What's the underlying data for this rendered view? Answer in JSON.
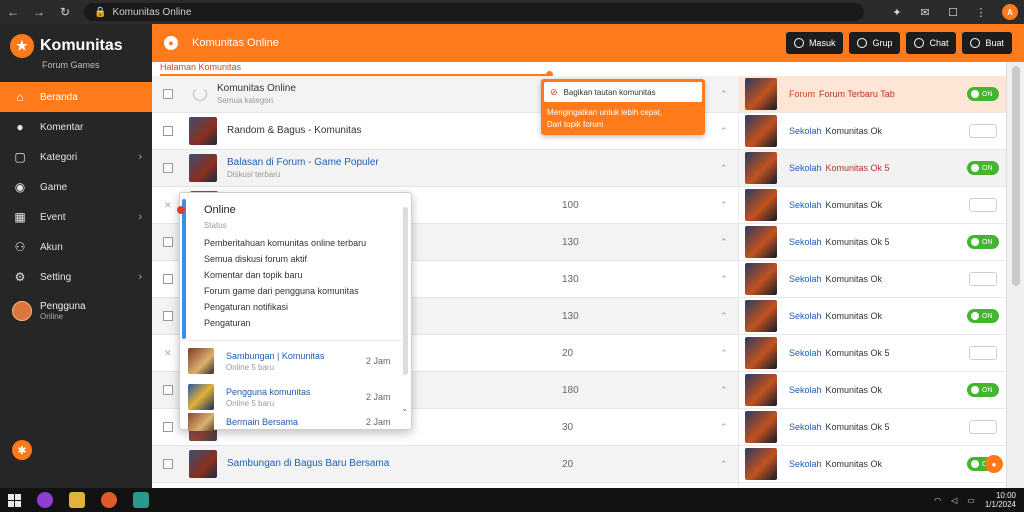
{
  "browser": {
    "url": "Komunitas Online",
    "nav_back": "←",
    "nav_forward": "→",
    "nav_reload": "↻"
  },
  "sidebar": {
    "brand_title": "Komunitas",
    "brand_sub": "Forum Games",
    "items": [
      {
        "label": "Beranda",
        "icon": "home-icon"
      },
      {
        "label": "Komentar",
        "icon": "comment-icon"
      },
      {
        "label": "Kategori",
        "icon": "category-icon"
      },
      {
        "label": "Game",
        "icon": "gamepad-icon"
      },
      {
        "label": "Event",
        "icon": "calendar-icon"
      },
      {
        "label": "Akun",
        "icon": "user-icon"
      },
      {
        "label": "Setting",
        "icon": "settings-icon"
      }
    ],
    "profile_name": "Pengguna",
    "profile_sub": "Online"
  },
  "header": {
    "title": "Komunitas Online",
    "buttons": [
      {
        "label": "Masuk"
      },
      {
        "label": "Grup"
      },
      {
        "label": "Chat"
      },
      {
        "label": "Buat"
      }
    ]
  },
  "substrip": {
    "label": "Halaman Komunitas"
  },
  "rows": [
    {
      "title": "Komunitas Online",
      "sub": "Semua kategori",
      "num": "",
      "type": "spinner",
      "dark": true
    },
    {
      "title": "Random & Bagus - Komunitas",
      "sub": "",
      "num": "",
      "type": "thumb",
      "dark": true
    },
    {
      "title": "Balasan di Forum - Game Populer",
      "sub": "Diskusi terbaru",
      "num": "",
      "type": "thumb",
      "dark": false
    },
    {
      "title": "",
      "sub": "",
      "num": "100",
      "type": "x",
      "dark": false
    },
    {
      "title": "",
      "sub": "",
      "num": "130",
      "type": "cb",
      "dark": false
    },
    {
      "title": "",
      "sub": "",
      "num": "130",
      "type": "cb",
      "dark": false
    },
    {
      "title": "",
      "sub": "",
      "num": "130",
      "type": "cb",
      "dark": false
    },
    {
      "title": "",
      "sub": "",
      "num": "20",
      "type": "x",
      "dark": false
    },
    {
      "title": "",
      "sub": "",
      "num": "180",
      "type": "cb",
      "dark": false
    },
    {
      "title": "",
      "sub": "",
      "num": "30",
      "type": "cb",
      "dark": false
    },
    {
      "title": "Sambungan di Bagus Baru Bersama",
      "sub": "",
      "num": "20",
      "type": "thumb",
      "dark": false
    }
  ],
  "tooltip": {
    "head": "Bagikan tautan komunitas",
    "body1": "Mengingatkan untuk lebih cepat,",
    "body2": "Dari topik forum"
  },
  "popup": {
    "title": "Online",
    "small": "Status",
    "lines": [
      "Pemberitahuan komunitas online terbaru",
      "Semua diskusi forum aktif",
      "Komentar dan topik baru",
      "Forum game dari pengguna komunitas",
      "Pengaturan notifikasi",
      "Pengaturan"
    ],
    "items": [
      {
        "title": "Sambungan | Komunitas",
        "sub": "Online 5 baru",
        "num": "2 Jam",
        "blue": false
      },
      {
        "title": "Pengguna komunitas",
        "sub": "Online 5 baru",
        "num": "2 Jam",
        "blue": true
      },
      {
        "title": "Bermain Bersama",
        "sub": "Online 5 baru",
        "num": "2 Jam",
        "blue": false
      }
    ]
  },
  "rpanel": [
    {
      "label": "Forum",
      "status": "Forum Terbaru Tab",
      "toggle": "on",
      "hl": true,
      "orange": true,
      "red": true
    },
    {
      "label": "Sekolah",
      "status": "Komunitas Ok",
      "toggle": "off",
      "hl": false,
      "orange": false,
      "red": false
    },
    {
      "label": "Sekolah",
      "status": "Komunitas Ok 5",
      "toggle": "on",
      "hl": false,
      "orange": false,
      "red": true,
      "alt": true
    },
    {
      "label": "Sekolah",
      "status": "Komunitas Ok",
      "toggle": "off",
      "hl": false,
      "orange": false,
      "red": false
    },
    {
      "label": "Sekolah",
      "status": "Komunitas Ok 5",
      "toggle": "on",
      "hl": false,
      "orange": false,
      "red": false
    },
    {
      "label": "Sekolah",
      "status": "Komunitas Ok",
      "toggle": "off",
      "hl": false,
      "orange": false,
      "red": false
    },
    {
      "label": "Sekolah",
      "status": "Komunitas Ok",
      "toggle": "on",
      "hl": false,
      "orange": false,
      "red": false
    },
    {
      "label": "Sekolah",
      "status": "Komunitas Ok 5",
      "toggle": "off",
      "hl": false,
      "orange": false,
      "red": false
    },
    {
      "label": "Sekolah",
      "status": "Komunitas Ok",
      "toggle": "on",
      "hl": false,
      "orange": false,
      "red": false
    },
    {
      "label": "Sekolah",
      "status": "Komunitas Ok 5",
      "toggle": "off",
      "hl": false,
      "orange": false,
      "red": false
    },
    {
      "label": "Sekolah",
      "status": "Komunitas Ok",
      "toggle": "on",
      "hl": false,
      "orange": false,
      "red": false,
      "chat": true
    }
  ],
  "taskbar": {
    "time": "10:00",
    "date": "1/1/2024"
  },
  "colors": {
    "accent": "#ff7a1a",
    "sidebar": "#262626",
    "link": "#1d5fb3",
    "toggle_on": "#44b52f"
  }
}
